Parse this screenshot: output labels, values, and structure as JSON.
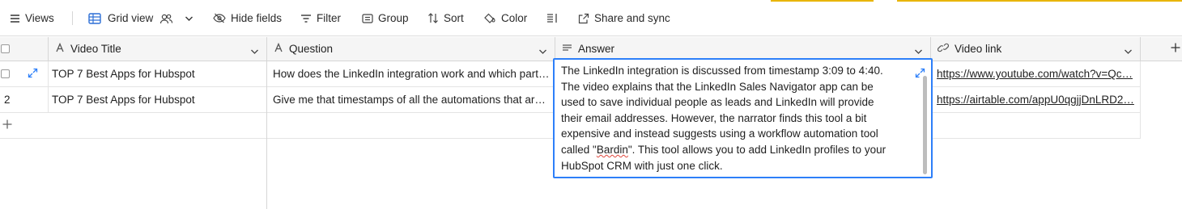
{
  "toolbar": {
    "views_label": "Views",
    "view_name": "Grid view",
    "hide_fields": "Hide fields",
    "filter": "Filter",
    "group": "Group",
    "sort": "Sort",
    "color": "Color",
    "share": "Share and sync"
  },
  "columns": [
    {
      "label": "Video Title",
      "icon": "text-a-icon"
    },
    {
      "label": "Question",
      "icon": "text-a-icon"
    },
    {
      "label": "Answer",
      "icon": "long-text-icon"
    },
    {
      "label": "Video link",
      "icon": "link-icon"
    }
  ],
  "rows": [
    {
      "number": "1",
      "title": "TOP 7 Best Apps for Hubspot",
      "question": "How does the LinkedIn integration work and which part…",
      "link": "https://www.youtube.com/watch?v=Qc…"
    },
    {
      "number": "2",
      "title": "TOP 7 Best Apps for Hubspot",
      "question": "Give me that timestamps of all the automations that ar…",
      "link": "https://airtable.com/appU0qgjjDnLRD2…"
    }
  ],
  "answer_expanded": {
    "before": "The LinkedIn integration is discussed from timestamp 3:09 to 4:40. The video explains that the LinkedIn Sales Navigator app can be used to save individual people as leads and LinkedIn will provide their email addresses. However, the narrator finds this tool a bit expensive and instead suggests using a workflow automation tool called \"",
    "misspelled": "Bardin",
    "after": "\". This tool allows you to add LinkedIn profiles to your HubSpot CRM with just one click."
  },
  "colors": {
    "accent": "#2d7ff9",
    "header_bg": "#f5f5f5",
    "top_highlight": "#e8b500",
    "spellcheck": "#e0463b"
  }
}
